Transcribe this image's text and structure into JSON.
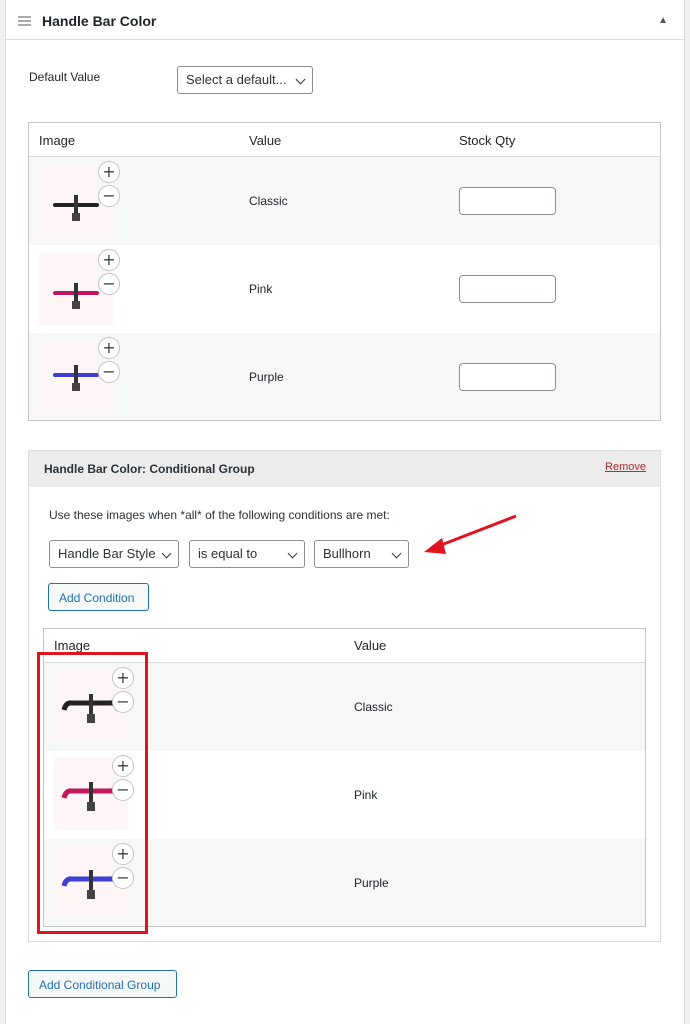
{
  "panel": {
    "title": "Handle Bar Color"
  },
  "default_value": {
    "label": "Default Value",
    "selected": "Select a default..."
  },
  "variants_table": {
    "headers": [
      "Image",
      "Value",
      "Stock Qty"
    ],
    "rows": [
      {
        "value": "Classic",
        "color": "#222222"
      },
      {
        "value": "Pink",
        "color": "#c2185b"
      },
      {
        "value": "Purple",
        "color": "#3f3fd6"
      }
    ]
  },
  "conditional_group": {
    "title": "Handle Bar Color: Conditional Group",
    "remove_label": "Remove",
    "instruction": "Use these images when *all* of the following conditions are met:",
    "condition": {
      "attribute": "Handle Bar Style",
      "operator": "is equal to",
      "value": "Bullhorn"
    },
    "add_condition_label": "Add Condition",
    "headers": [
      "Image",
      "Value"
    ],
    "rows": [
      {
        "value": "Classic",
        "color": "#222222"
      },
      {
        "value": "Pink",
        "color": "#c2185b"
      },
      {
        "value": "Purple",
        "color": "#3f3fd6"
      }
    ]
  },
  "add_group_label": "Add Conditional Group",
  "icons": {
    "add": "+",
    "remove": "−",
    "collapse": "▲"
  },
  "annotation_colors": {
    "highlight": "#e0141f"
  }
}
